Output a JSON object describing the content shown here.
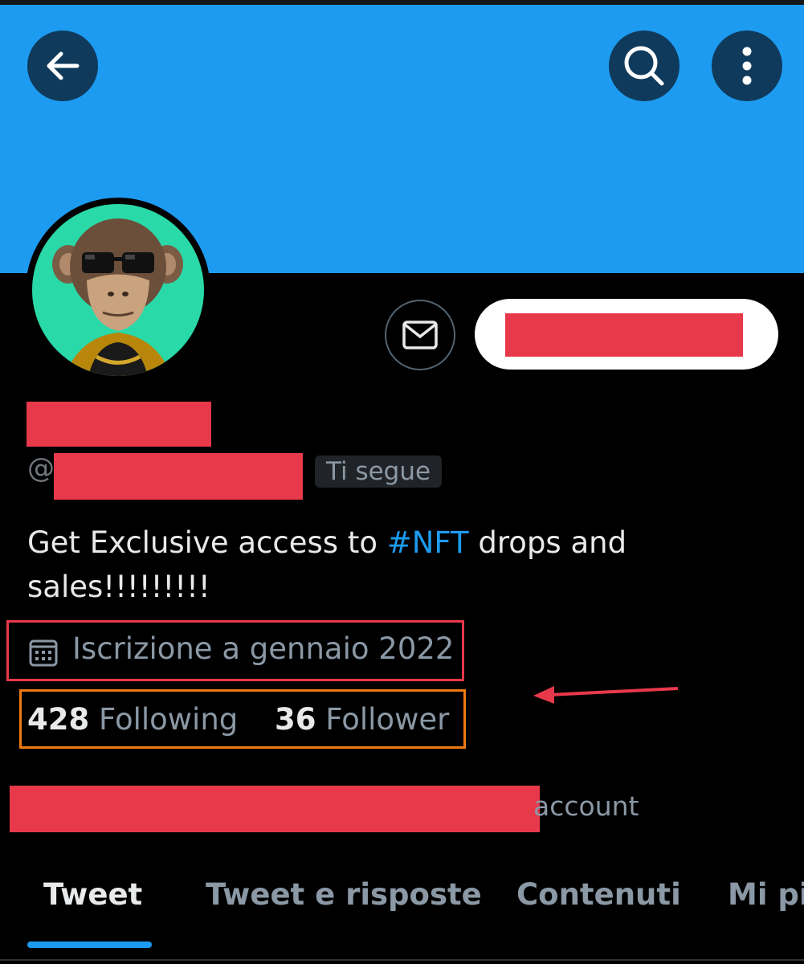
{
  "header": {
    "back_icon": "arrow-left-icon",
    "search_icon": "search-icon",
    "more_icon": "more-vertical-icon",
    "banner_color": "#1d9bf0"
  },
  "profile": {
    "avatar_icon": "ape-avatar",
    "message_icon": "mail-icon",
    "handle_prefix": "@",
    "follows_you": "Ti segue",
    "bio_before": "Get Exclusive access to ",
    "bio_hashtag": "#NFT",
    "bio_after": " drops and sales!!!!!!!!!",
    "joined": "Iscrizione a gennaio 2022",
    "following_count": "428",
    "following_label": "Following",
    "followers_count": "36",
    "followers_label": "Follower",
    "account_fragment": "account"
  },
  "tabs": [
    {
      "label": "Tweet",
      "active": true
    },
    {
      "label": "Tweet e risposte",
      "active": false
    },
    {
      "label": "Contenuti",
      "active": false
    },
    {
      "label": "Mi pi",
      "active": false
    }
  ],
  "colors": {
    "accent": "#1d9bf0",
    "redaction": "#e8394b",
    "annotation_red": "#e8394b",
    "annotation_orange": "#f07a12"
  }
}
